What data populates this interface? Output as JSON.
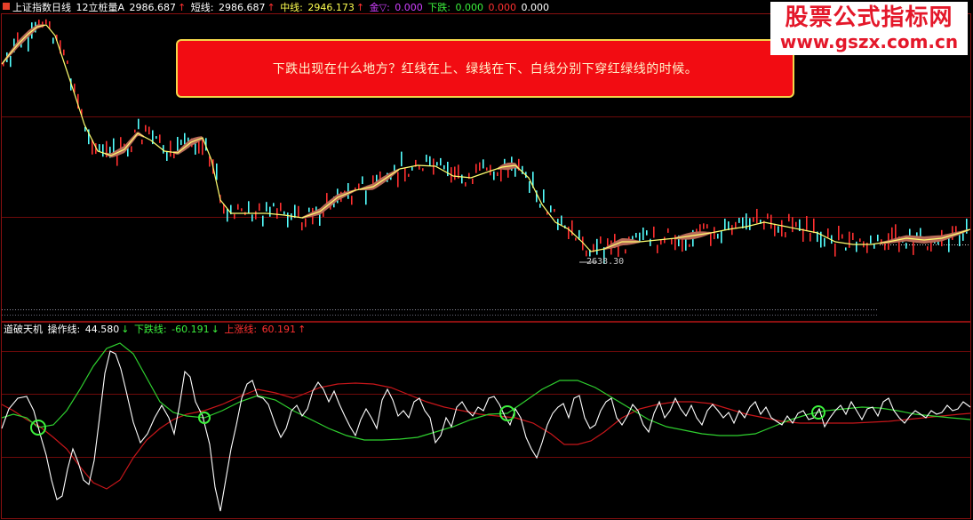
{
  "top_panel": {
    "title": "上证指数日线",
    "indicator_name": "12立桩量A",
    "value": "2986.687",
    "short_label": "短线:",
    "short_value": "2986.687",
    "mid_label": "中线:",
    "mid_value": "2946.173",
    "gold_label": "金▽:",
    "gold_value": "0.000",
    "down_label": "下跌:",
    "down_value": "0.000",
    "extra_value_1": "0.000",
    "extra_value_2": "0.000",
    "low_price": "2638.30"
  },
  "note": {
    "text": "下跌出现在什么地方？红线在上、绿线在下、白线分别下穿红绿线的时候。"
  },
  "watermark": {
    "line1": "股票公式指标网",
    "line2": "www.gszx.com.cn"
  },
  "bottom_panel": {
    "title": "道破天机",
    "op_label": "操作线:",
    "op_value": "44.580",
    "down_label": "下跌线:",
    "down_value": "-60.191",
    "up_label": "上涨线:",
    "up_value": "60.191"
  },
  "colors": {
    "up_candle": "#ff3030",
    "down_candle": "#54ffff",
    "mid_line": "#ffff70",
    "band_fill": "#b86a58",
    "green_line": "#2fd12f",
    "red_line": "#c8161a",
    "white_line": "#ffffff",
    "circle": "#3cf03c",
    "grid": "#7a0a0a"
  }
}
